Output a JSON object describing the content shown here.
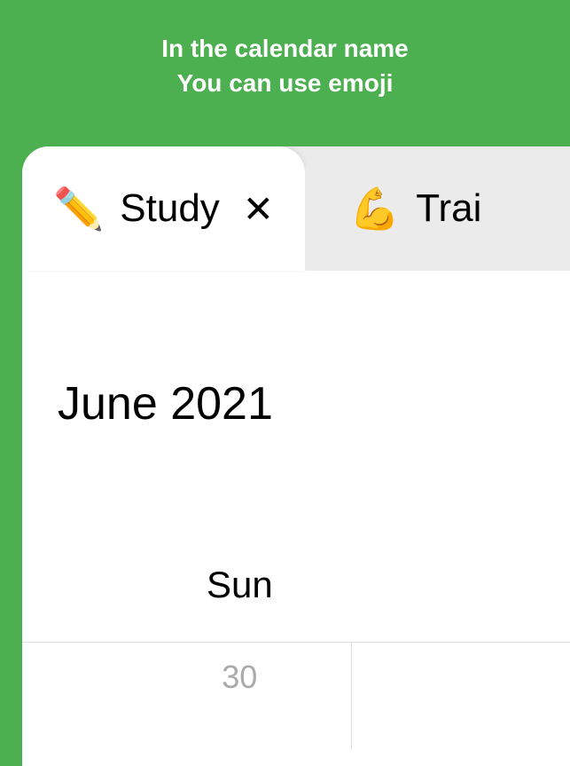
{
  "promo": {
    "line1": "In the calendar name",
    "line2": "You can use emoji"
  },
  "tabs": [
    {
      "icon": "✏️",
      "label": "Study",
      "active": true,
      "closable": true
    },
    {
      "icon": "💪",
      "label": "Trai",
      "active": false,
      "closable": false
    }
  ],
  "calendar": {
    "month_title": "June 2021",
    "weekday": "Sun",
    "prev_month_day": "30"
  }
}
